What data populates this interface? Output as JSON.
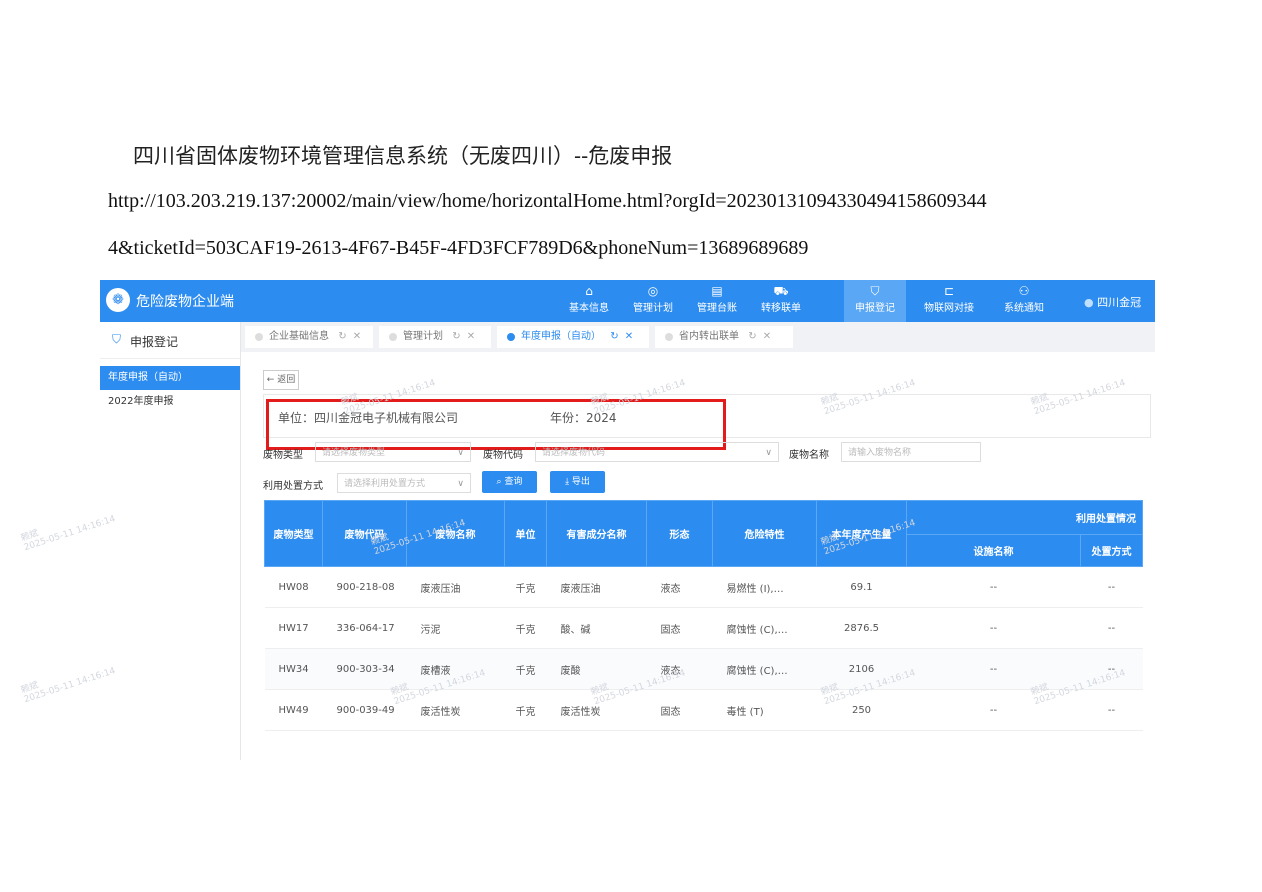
{
  "doc": {
    "title": "四川省固体废物环境管理信息系统（无废四川）--危废申报",
    "url_line1": "http://103.203.219.137:20002/main/view/home/horizontalHome.html?orgId=20230131094330494158609344",
    "url_line2": "4&ticketId=503CAF19-2613-4F67-B45F-4FD3FCF789D6&phoneNum=13689689689"
  },
  "app": {
    "title": "危险废物企业端",
    "user": "四川金冠",
    "brand_color": "#2d8cf0"
  },
  "nav": [
    {
      "label": "基本信息",
      "icon": "building-icon"
    },
    {
      "label": "管理计划",
      "icon": "target-icon"
    },
    {
      "label": "管理台账",
      "icon": "ledger-icon"
    },
    {
      "label": "转移联单",
      "icon": "truck-icon"
    },
    {
      "label": "申报登记",
      "icon": "shield-icon"
    },
    {
      "label": "物联网对接",
      "icon": "link-icon"
    },
    {
      "label": "系统通知",
      "icon": "users-icon"
    }
  ],
  "sidebar": {
    "header": "申报登记",
    "items": [
      "年度申报（自动）",
      "2022年度申报"
    ]
  },
  "tabs": [
    "企业基础信息",
    "管理计划",
    "年度申报（自动）",
    "省内转出联单"
  ],
  "content": {
    "back": "← 返回",
    "unit": "单位：四川金冠电子机械有限公司",
    "year": "年份：2024"
  },
  "filters": {
    "type_label": "废物类型",
    "type_placeholder": "请选择废物类型",
    "code_label": "废物代码",
    "code_placeholder": "请选择废物代码",
    "name_label": "废物名称",
    "name_placeholder": "请输入废物名称",
    "method_label": "利用处置方式",
    "method_placeholder": "请选择利用处置方式",
    "query": "查询",
    "export": "导出"
  },
  "table": {
    "headers": [
      "废物类型",
      "废物代码",
      "废物名称",
      "单位",
      "有害成分名称",
      "形态",
      "危险特性",
      "本年度产生量"
    ],
    "group_header": "利用处置情况",
    "sub_headers": [
      "设施名称",
      "处置方式"
    ],
    "rows": [
      [
        "HW08",
        "900-218-08",
        "废液压油",
        "千克",
        "废液压油",
        "液态",
        "易燃性 (I),…",
        "69.1",
        "--",
        "--"
      ],
      [
        "HW17",
        "336-064-17",
        "污泥",
        "千克",
        "酸、碱",
        "固态",
        "腐蚀性 (C),…",
        "2876.5",
        "--",
        "--"
      ],
      [
        "HW34",
        "900-303-34",
        "废槽液",
        "千克",
        "废酸",
        "液态",
        "腐蚀性 (C),…",
        "2106",
        "--",
        "--"
      ],
      [
        "HW49",
        "900-039-49",
        "废活性炭",
        "千克",
        "废活性炭",
        "固态",
        "毒性 (T)",
        "250",
        "--",
        "--"
      ]
    ]
  },
  "watermark": {
    "name": "赖斌",
    "time": "2025-05-11 14:16:14"
  }
}
